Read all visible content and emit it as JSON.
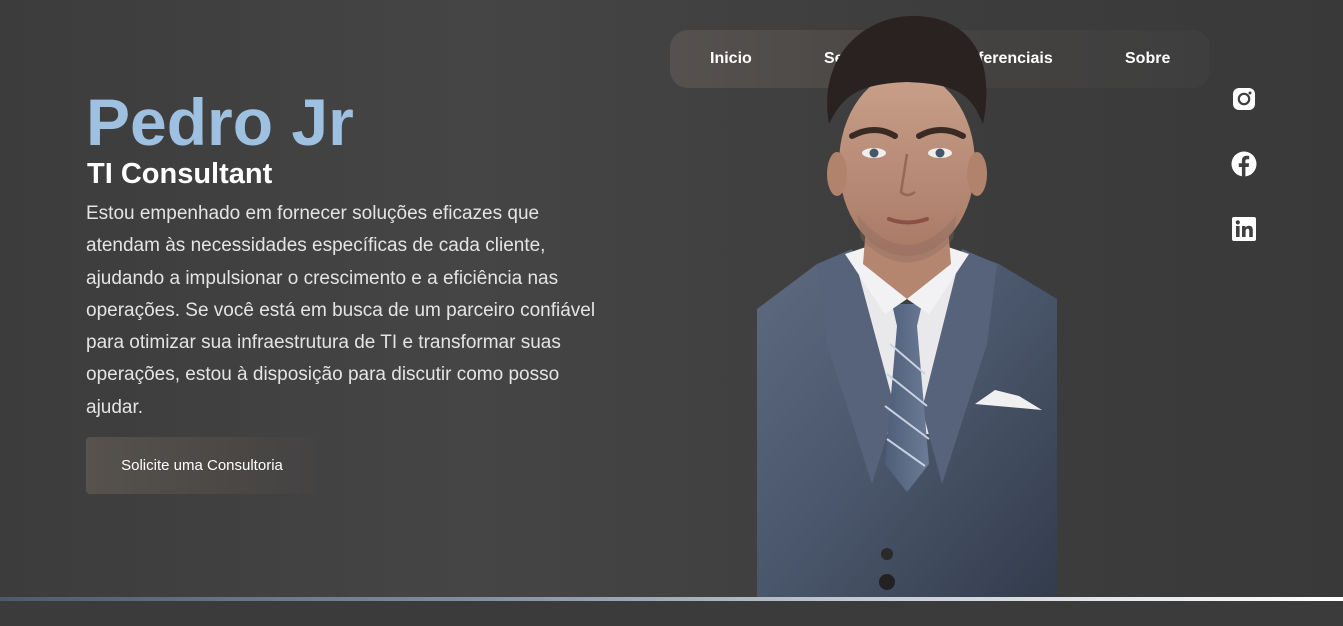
{
  "nav": {
    "items": [
      {
        "label": "Inicio"
      },
      {
        "label": "Serviços"
      },
      {
        "label": "Diferenciais"
      },
      {
        "label": "Sobre"
      }
    ]
  },
  "hero": {
    "name": "Pedro Jr",
    "role": "TI Consultant",
    "description": "Estou empenhado em fornecer soluções eficazes que atendam às necessidades específicas de cada cliente, ajudando a impulsionar o crescimento e a eficiência nas operações. Se você está em busca de um parceiro confiável para otimizar sua infraestrutura de TI e transformar suas operações, estou à disposição para discutir como posso ajudar.",
    "cta_label": "Solicite uma Consultoria"
  },
  "social": {
    "icons": [
      "instagram-icon",
      "facebook-icon",
      "linkedin-icon"
    ]
  },
  "colors": {
    "accent": "#9fc1e1",
    "background": "#3f3f3f",
    "text": "#ffffff"
  }
}
